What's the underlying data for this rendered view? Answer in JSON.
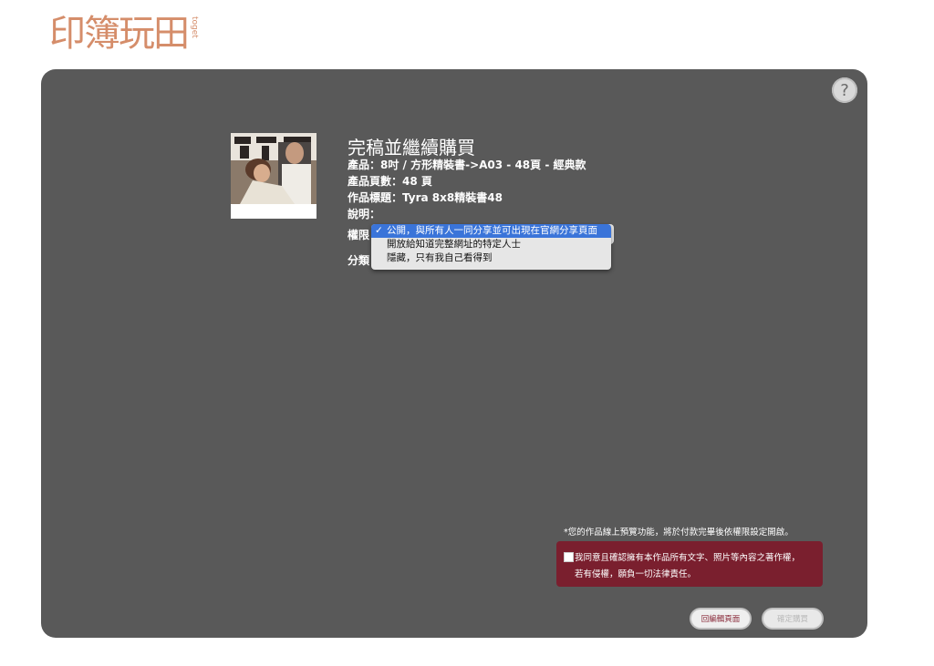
{
  "logo": {
    "text": "印簿玩田",
    "sub": "toget"
  },
  "help": {
    "icon": "help-icon",
    "symbol": "?"
  },
  "product": {
    "heading": "完稿並繼續購買",
    "line1": "產品：8吋 / 方形精裝書->A03 - 48頁 - 經典款",
    "line2": "產品頁數：48 頁",
    "line3": "作品標題：Tyra 8x8精裝書48",
    "line4": "說明："
  },
  "permission": {
    "label": "權限",
    "options": [
      "公開，與所有人一同分享並可出現在官網分享頁面",
      "開放給知道完整網址的特定人士",
      "隱藏，只有我自己看得到"
    ],
    "selected_index": 0
  },
  "category": {
    "label": "分類"
  },
  "note": "*您的作品線上預覽功能，將於付款完畢後依權限設定開啟。",
  "agree": {
    "line1": "我同意且確認擁有本作品所有文字、照片等內容之著作權，",
    "line2": "若有侵權，願負一切法律責任。"
  },
  "buttons": {
    "edit": "回編輯頁面",
    "buy": "確定購買"
  },
  "colors": {
    "panel": "#595959",
    "accent": "#7a1f2e",
    "select_highlight": "#3a74d9",
    "logo": "#d58d6a"
  }
}
